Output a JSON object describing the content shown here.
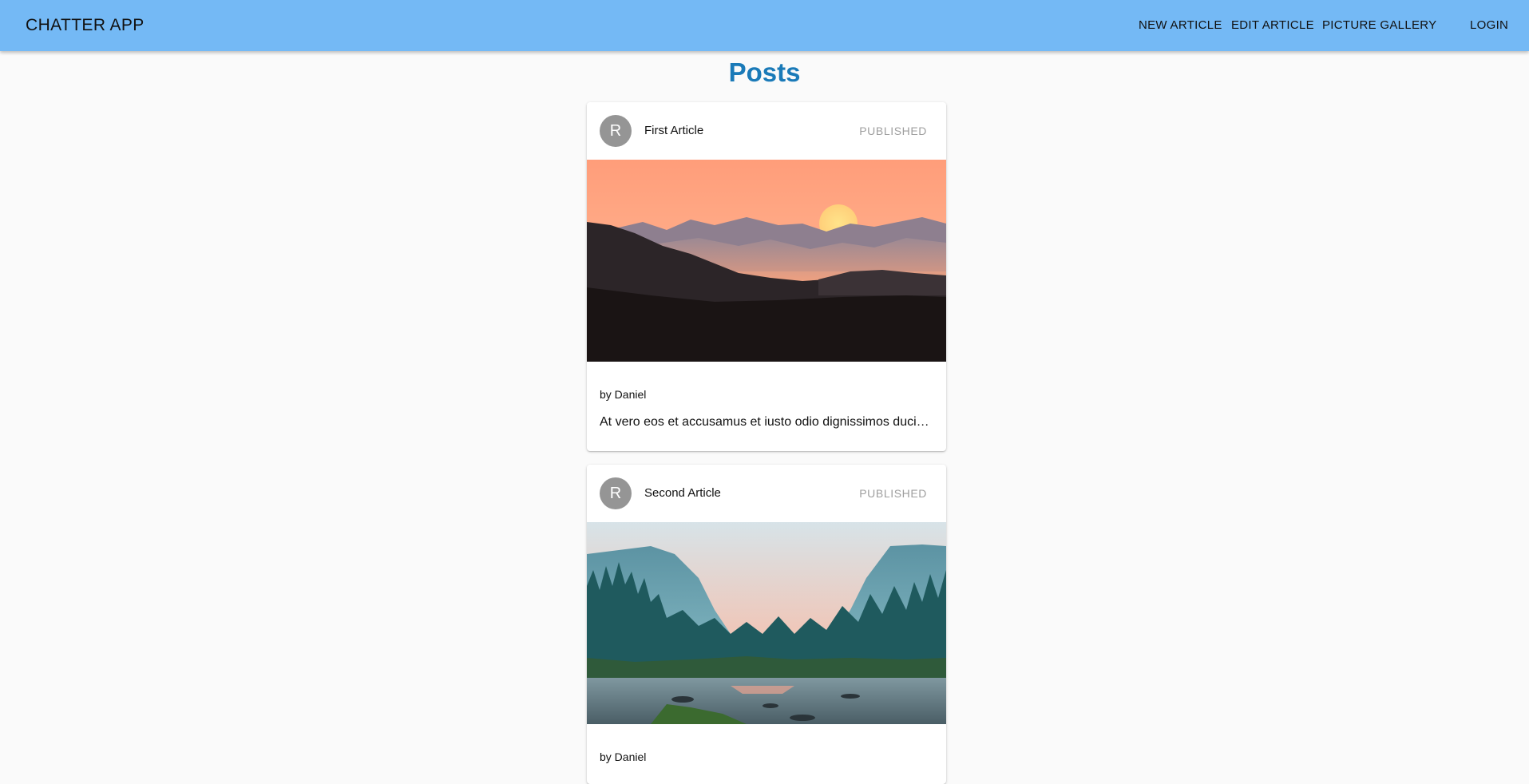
{
  "app": {
    "title": "CHATTER APP"
  },
  "nav": {
    "new_article": "NEW ARTICLE",
    "edit_article": "EDIT ARTICLE",
    "picture_gallery": "PICTURE GALLERY",
    "login": "LOGIN"
  },
  "page": {
    "title": "Posts"
  },
  "posts": [
    {
      "avatar_initial": "R",
      "title": "First Article",
      "status": "PUBLISHED",
      "image": "sunset-mountains-image",
      "author": "by Daniel",
      "excerpt": "At vero eos et accusamus et iusto odio dignissimos ducimus qui blanditiis praesentium voluptatum deleniti atque corrupti"
    },
    {
      "avatar_initial": "R",
      "title": "Second Article",
      "status": "PUBLISHED",
      "image": "forest-river-valley-image",
      "author": "by Daniel",
      "excerpt": ""
    }
  ],
  "colors": {
    "appbar": "#74b9f5",
    "page_title": "#1a7ab8",
    "avatar": "#959595",
    "status": "#9e9e9e",
    "background": "#fafafa"
  }
}
